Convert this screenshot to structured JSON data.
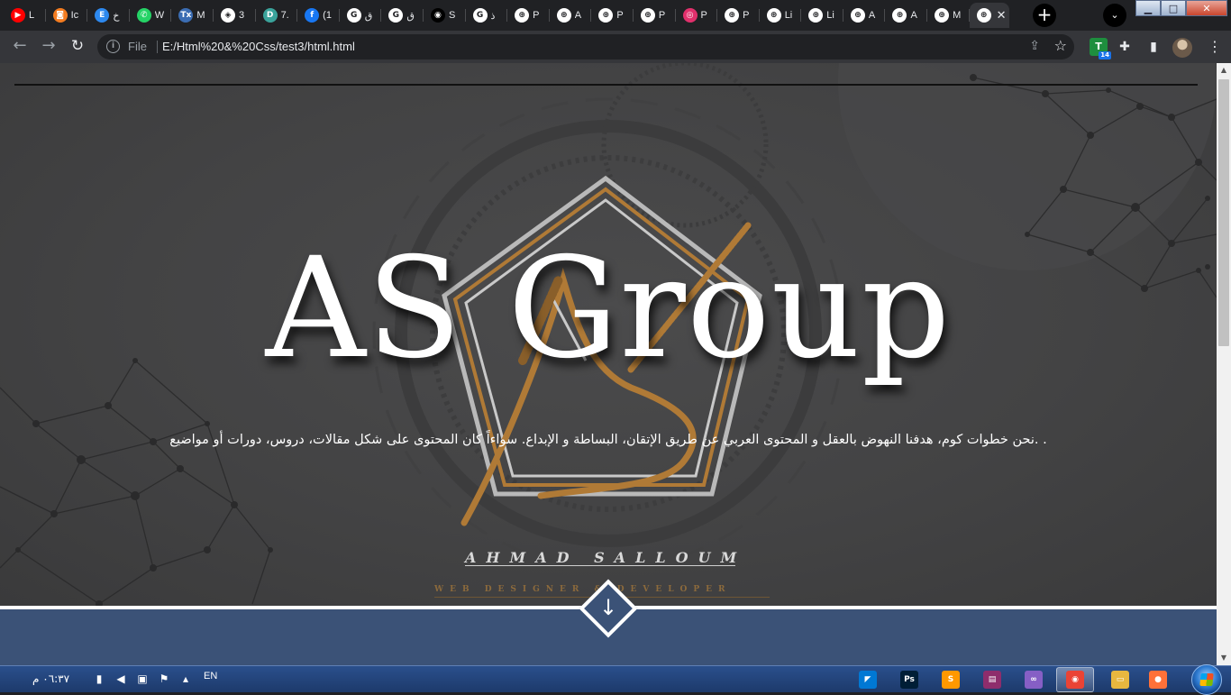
{
  "browser": {
    "tabs": [
      {
        "title": "L",
        "icon": "youtube-icon",
        "color": "#ff0000",
        "glyph": "▶"
      },
      {
        "title": "Ic",
        "icon": "icon-app-icon",
        "color": "#f47c20",
        "glyph": "◙"
      },
      {
        "title": "خ",
        "icon": "e-letter-icon",
        "color": "#2d89ef",
        "glyph": "E"
      },
      {
        "title": "W",
        "icon": "whatsapp-icon",
        "color": "#25d366",
        "glyph": "✆"
      },
      {
        "title": "M",
        "icon": "tex-icon",
        "color": "#3b6db3",
        "glyph": "Tx"
      },
      {
        "title": "3",
        "icon": "codepen-icon",
        "color": "#ffffff",
        "glyph": "◈"
      },
      {
        "title": "7.",
        "icon": "d-letter-icon",
        "color": "#3aa39b",
        "glyph": "D"
      },
      {
        "title": "(1",
        "icon": "facebook-icon",
        "color": "#1877f2",
        "glyph": "f"
      },
      {
        "title": "ق",
        "icon": "google-icon",
        "color": "#ffffff",
        "glyph": "G"
      },
      {
        "title": "ق",
        "icon": "google-icon",
        "color": "#ffffff",
        "glyph": "G"
      },
      {
        "title": "S",
        "icon": "github-icon",
        "color": "#000000",
        "glyph": "◉"
      },
      {
        "title": "ذ",
        "icon": "google-icon",
        "color": "#ffffff",
        "glyph": "G"
      },
      {
        "title": "P",
        "icon": "globe-icon",
        "color": "#ffffff",
        "glyph": "⊕"
      },
      {
        "title": "A",
        "icon": "globe-icon",
        "color": "#ffffff",
        "glyph": "⊕"
      },
      {
        "title": "P",
        "icon": "globe-icon",
        "color": "#ffffff",
        "glyph": "⊕"
      },
      {
        "title": "P",
        "icon": "globe-icon",
        "color": "#ffffff",
        "glyph": "⊕"
      },
      {
        "title": "P",
        "icon": "instagram-icon",
        "color": "#e1306c",
        "glyph": "◎"
      },
      {
        "title": "P",
        "icon": "globe-icon",
        "color": "#ffffff",
        "glyph": "⊕"
      },
      {
        "title": "Li",
        "icon": "globe-icon",
        "color": "#ffffff",
        "glyph": "⊕"
      },
      {
        "title": "Li",
        "icon": "globe-icon",
        "color": "#ffffff",
        "glyph": "⊕"
      },
      {
        "title": "A",
        "icon": "globe-icon",
        "color": "#ffffff",
        "glyph": "⊕"
      },
      {
        "title": "A",
        "icon": "globe-icon",
        "color": "#ffffff",
        "glyph": "⊕"
      },
      {
        "title": "M",
        "icon": "globe-icon",
        "color": "#ffffff",
        "glyph": "⊕"
      }
    ],
    "active_tab": {
      "icon": "globe-icon",
      "close_glyph": "✕"
    },
    "new_tab_glyph": "+",
    "tab_search_glyph": "⌄",
    "window": {
      "minimize": "▁",
      "maximize": "□",
      "close": "✕"
    },
    "toolbar": {
      "back_glyph": "←",
      "forward_glyph": "→",
      "reload_glyph": "↻",
      "scheme_label": "File",
      "url": "E:/Html%20&%20Css/test3/html.html",
      "share_glyph": "⇪",
      "star_glyph": "☆",
      "extension_label": "T",
      "extension_badge": "14",
      "puzzle_glyph": "✚",
      "sidepanel_glyph": "▮",
      "menu_glyph": "⋮"
    }
  },
  "page": {
    "hero_title": "AS Group",
    "description": ". .نحن خطوات كوم، هدفنا النهوض بالعقل و المحتوى العربي عن طريق الإتقان، البساطة و الإبداع. سواءاً كان المحتوى على شكل مقالات، دروس، دورات أو مواضيع",
    "signature_name": "AHMAD SALLOUM",
    "signature_role": "WEB DESIGNER & DEVELOPER",
    "scroll_down_glyph": "↓",
    "colors": {
      "accent_gold": "#b07a36",
      "lower_section": "#3b5277"
    }
  },
  "taskbar": {
    "clock": "٠٦:٣٧ م",
    "language": "EN",
    "apps": [
      {
        "name": "vscode",
        "icon": "vscode-icon",
        "color": "#0078d4",
        "glyph": "◤"
      },
      {
        "name": "photoshop",
        "icon": "photoshop-icon",
        "color": "#001e36",
        "glyph": "Ps"
      },
      {
        "name": "sublime",
        "icon": "sublime-icon",
        "color": "#ff9800",
        "glyph": "S"
      },
      {
        "name": "winrar",
        "icon": "winrar-icon",
        "color": "#8e2d6c",
        "glyph": "▤"
      },
      {
        "name": "visual-studio",
        "icon": "visual-studio-icon",
        "color": "#865fc5",
        "glyph": "∞"
      },
      {
        "name": "chrome",
        "icon": "chrome-icon",
        "color": "#ea4335",
        "glyph": "◉"
      },
      {
        "name": "explorer",
        "icon": "folder-icon",
        "color": "#e8b73f",
        "glyph": "▭"
      },
      {
        "name": "firefox",
        "icon": "firefox-icon",
        "color": "#ff7139",
        "glyph": "●"
      }
    ]
  }
}
